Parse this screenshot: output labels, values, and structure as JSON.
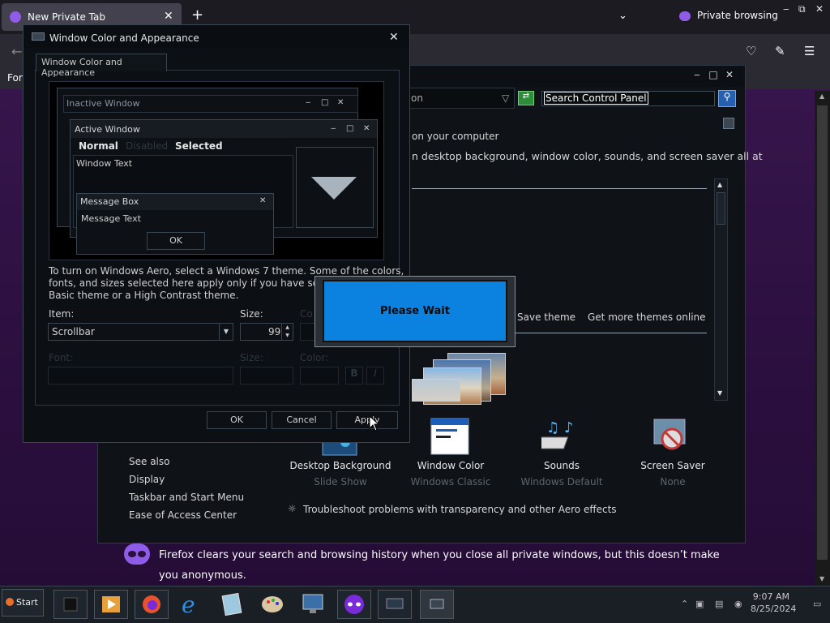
{
  "browser": {
    "tab_title": "New Private Tab",
    "tab_close": "✕",
    "new_tab": "+",
    "private_label": "Private browsing",
    "bookmark_text": "For",
    "window_controls": [
      "‒",
      "⧉",
      "✕"
    ]
  },
  "control_panel": {
    "address_text": "on",
    "search_placeholder": "Search Control Panel",
    "intro_line1": "on your computer",
    "intro_line2": "n desktop background, window color, sounds, and screen saver all at",
    "save_theme": "Save theme",
    "get_more_themes": "Get more themes online",
    "tiles": [
      {
        "label": "Desktop Background",
        "sub": "Slide Show"
      },
      {
        "label": "Window Color",
        "sub": "Windows Classic"
      },
      {
        "label": "Sounds",
        "sub": "Windows Default"
      },
      {
        "label": "Screen Saver",
        "sub": "None"
      }
    ],
    "see_also": {
      "heading": "See also",
      "items": [
        "Display",
        "Taskbar and Start Menu",
        "Ease of Access Center"
      ]
    },
    "troubleshoot": "Troubleshoot problems with transparency and other Aero effects"
  },
  "firefox_message": "Firefox clears your search and browsing history when you close all private windows, but this doesn’t make you anonymous.",
  "dialog": {
    "title": "Window Color and Appearance",
    "tab_label": "Window Color and Appearance",
    "preview": {
      "inactive_window": "Inactive Window",
      "active_window": "Active Window",
      "menu_normal": "Normal",
      "menu_disabled": "Disabled",
      "menu_selected": "Selected",
      "window_text": "Window Text",
      "message_box": "Message Box",
      "message_text": "Message Text",
      "ok": "OK"
    },
    "info_line1": "To turn on Windows Aero, select a Windows 7 theme.  Some of the colors,",
    "info_line2": "fonts, and sizes selected here apply only if you have selected th",
    "info_line3": "Basic theme or a High Contrast theme.",
    "item_label": "Item:",
    "item_value": "Scrollbar",
    "size_label": "Size:",
    "size_value": "99",
    "color_label_1": "Co",
    "font_label": "Font:",
    "font_size_label": "Size:",
    "color_label_2": "Color:",
    "bold_btn": "B",
    "italic_btn": "I",
    "ok_button": "OK",
    "cancel_button": "Cancel",
    "apply_button": "Apply"
  },
  "please_wait": "Please Wait",
  "taskbar": {
    "start": "Start",
    "time": "9:07 AM",
    "date": "8/25/2024"
  }
}
